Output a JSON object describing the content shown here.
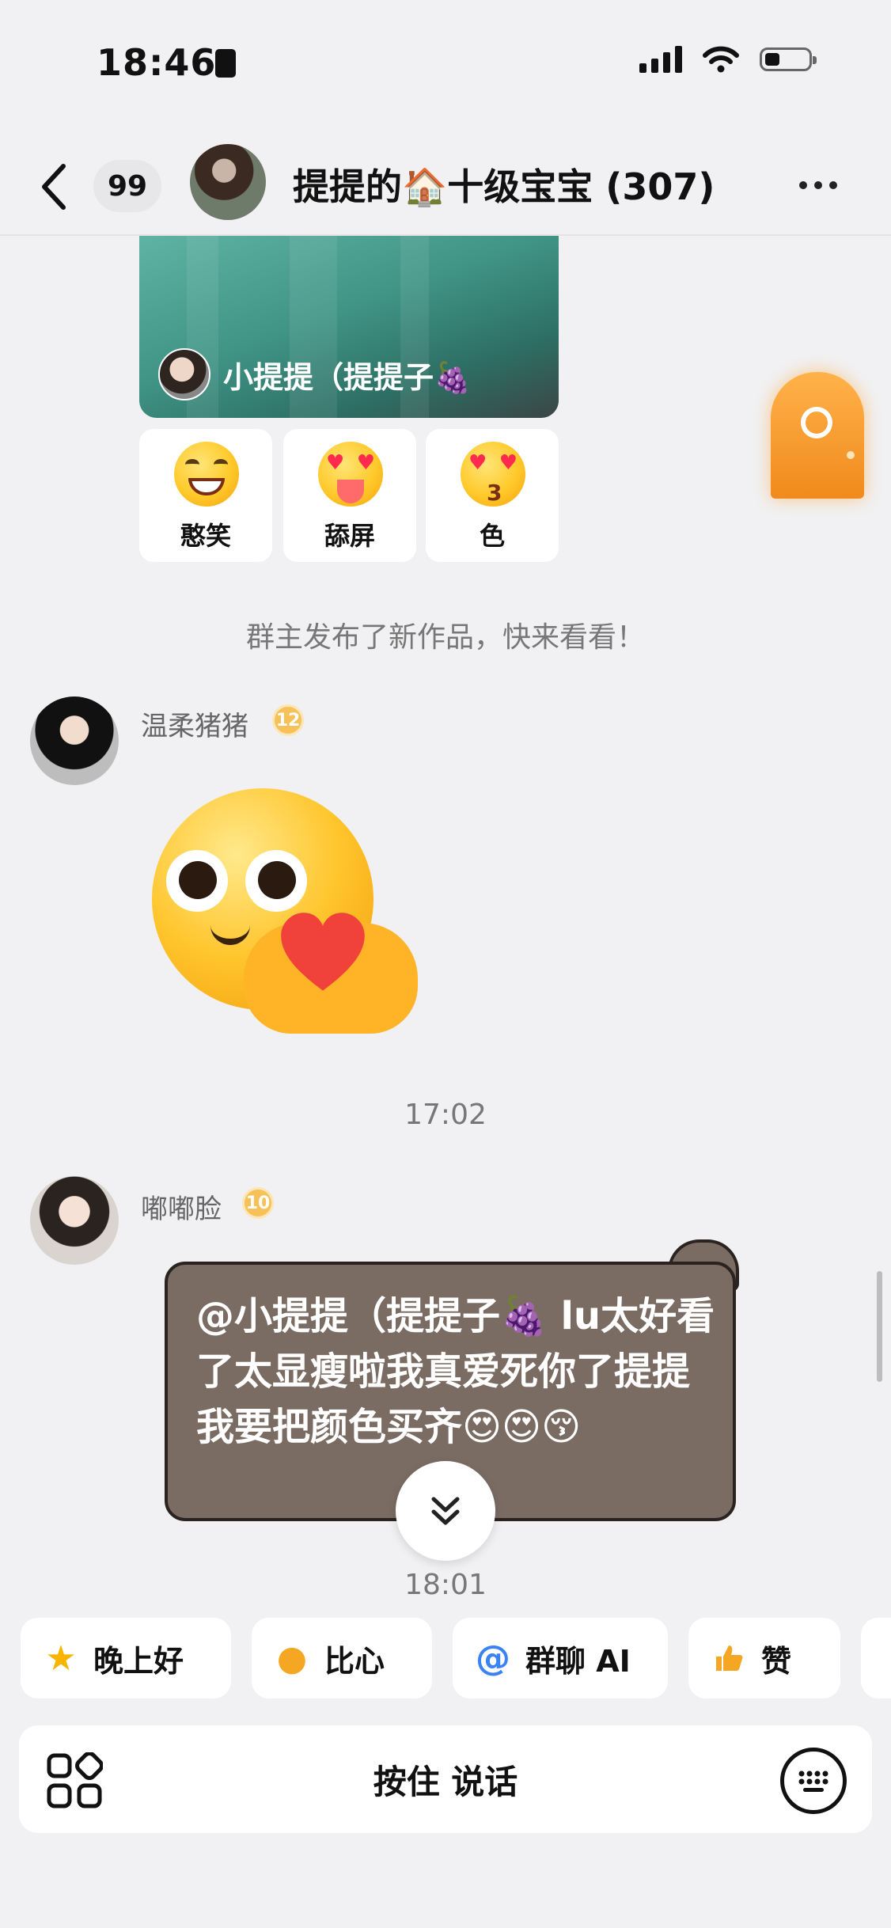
{
  "status_bar": {
    "time": "18:46"
  },
  "nav": {
    "unread_count": "99",
    "title": "提提的🏠十级宝宝 (307)"
  },
  "post": {
    "author": "小提提（提提子🍇",
    "reactions": [
      {
        "label": "憨笑",
        "icon": "grin-emoji-icon"
      },
      {
        "label": "舔屏",
        "icon": "heart-eyes-tongue-emoji-icon"
      },
      {
        "label": "色",
        "icon": "heart-eyes-kiss-emoji-icon"
      }
    ]
  },
  "notice": "群主发布了新作品，快来看看！",
  "messages": [
    {
      "sender": "温柔猪猪",
      "level": "12",
      "type": "sticker",
      "sticker": "heart-hands-emoji"
    },
    {
      "time": "17:02"
    },
    {
      "sender": "嘟嘟脸",
      "level": "10",
      "type": "text",
      "text": "@小提提（提提子🍇 lu太好看了太显瘦啦我真爱死你了提提 我要把颜色买齐😍😍😚"
    },
    {
      "time": "18:01"
    }
  ],
  "quick_replies": [
    {
      "label": "晚上好",
      "icon": "star-face-icon"
    },
    {
      "label": "比心",
      "icon": "finger-heart-icon"
    },
    {
      "label": "群聊 AI",
      "icon": "at-sign-icon"
    },
    {
      "label": "赞",
      "icon": "thumbs-up-icon"
    }
  ],
  "input": {
    "hold_to_talk": "按住 说话"
  },
  "colors": {
    "bubble": "#7a6b63",
    "background": "#f1f1f3",
    "accent_blue": "#3b82f6"
  }
}
